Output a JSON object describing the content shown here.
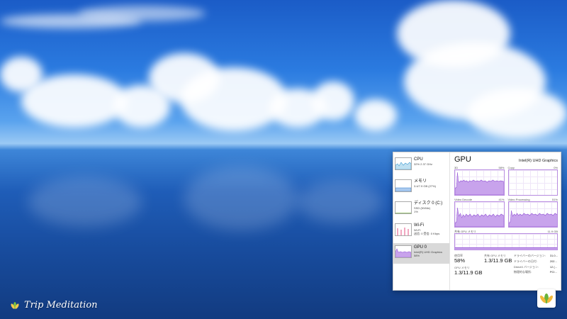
{
  "watermark": {
    "brand": "Trip Meditation"
  },
  "task_manager": {
    "sidebar": [
      {
        "name": "CPU",
        "line1": "32%  2.37 GHz",
        "line2": ""
      },
      {
        "name": "メモリ",
        "line1": "3.4/7.9 GB (27%)",
        "line2": ""
      },
      {
        "name": "ディスク 0 (C:)",
        "line1": "SSD (NVMe)",
        "line2": "1%"
      },
      {
        "name": "Wi-Fi",
        "line1": "Wi-Fi",
        "line2": "送信: 0  受信: 0 Kbps"
      },
      {
        "name": "GPU 0",
        "line1": "Intel(R) UHD Graphics",
        "line2": "58%"
      }
    ],
    "title": "GPU",
    "adapter": "Intel(R) UHD Graphics",
    "graphs": [
      {
        "label": "3D",
        "value": "58%"
      },
      {
        "label": "Copy",
        "value": "0%"
      },
      {
        "label": "Video Decode",
        "value": "41%"
      },
      {
        "label": "Video Processing",
        "value": "51%"
      }
    ],
    "memory": {
      "label": "共有 GPU メモリ",
      "value": "11.9 GB"
    },
    "stats": {
      "util_label": "使用率",
      "util_value": "58%",
      "shared_label": "共有 GPU メモリ",
      "shared_value": "1.3/11.9 GB",
      "gpumem_label": "GPU メモリ",
      "gpumem_value": "1.3/11.9 GB"
    },
    "info": [
      {
        "k": "ドライバーのバージョン:",
        "v": "31.0..."
      },
      {
        "k": "ドライバーの日付:",
        "v": "202..."
      },
      {
        "k": "DirectX バージョン:",
        "v": "12 (..."
      },
      {
        "k": "物理的な場所:",
        "v": "PCI..."
      }
    ]
  },
  "colors": {
    "gpu_line": "#9a5fd8",
    "gpu_fill": "#c8a3ec",
    "frame": "#b78be0"
  }
}
